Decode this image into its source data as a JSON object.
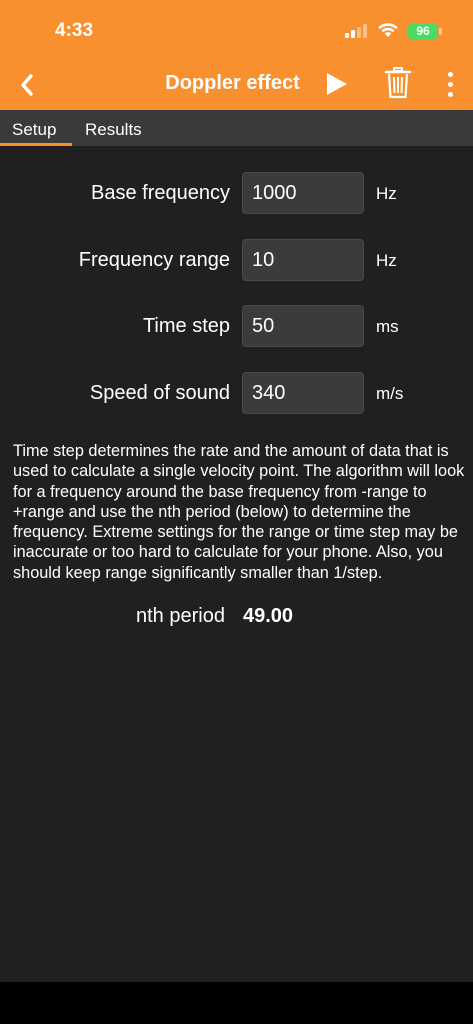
{
  "status_bar": {
    "time": "4:33",
    "battery": "96"
  },
  "header": {
    "title": "Doppler effect",
    "back_icon": "chevron-left-icon",
    "play_icon": "play-icon",
    "trash_icon": "trash-icon",
    "more_icon": "more-vertical-icon",
    "background_color": "#f8902f"
  },
  "tabs": [
    {
      "label": "Setup",
      "active": true
    },
    {
      "label": "Results",
      "active": false
    }
  ],
  "settings": [
    {
      "label": "Base frequency",
      "value": "1000",
      "unit": "Hz"
    },
    {
      "label": "Frequency range",
      "value": "10",
      "unit": "Hz"
    },
    {
      "label": "Time step",
      "value": "50",
      "unit": "ms"
    },
    {
      "label": "Speed of sound",
      "value": "340",
      "unit": "m/s"
    }
  ],
  "description": "Time step determines the rate and the amount of data that is used to calculate a single velocity point. The algorithm will look for a frequency around the base frequency from -range to +range and use the nth period (below) to determine the frequency. Extreme settings for the range or time step may be inaccurate or too hard to calculate for your phone. Also, you should keep range significantly smaller than 1/step.",
  "nth_period": {
    "label": "nth period",
    "value": "49.00"
  }
}
